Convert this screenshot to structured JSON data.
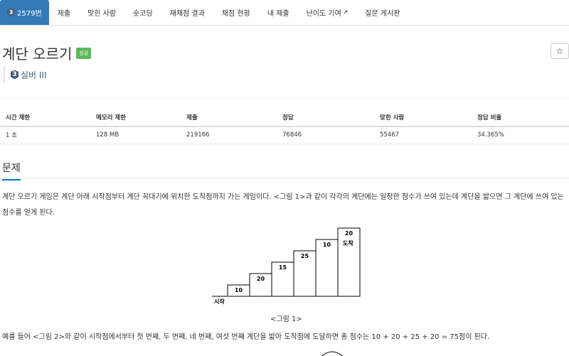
{
  "nav": {
    "tabs": [
      {
        "label": "2579번",
        "tier": "3"
      },
      {
        "label": "제출"
      },
      {
        "label": "맞힌 사람"
      },
      {
        "label": "숏코딩"
      },
      {
        "label": "재채점 결과"
      },
      {
        "label": "채점 현황"
      },
      {
        "label": "내 제출"
      },
      {
        "label": "난이도 기여"
      },
      {
        "label": "질문 게시판"
      }
    ],
    "active_color": "#337ab7"
  },
  "problem": {
    "title": "계단 오르기",
    "status_badge": "성공",
    "star": "☆",
    "tier_num": "3",
    "tier_label": "실버 III"
  },
  "info_table": {
    "headers": [
      "시간 제한",
      "메모리 제한",
      "제출",
      "정답",
      "맞힌 사람",
      "정답 비율"
    ],
    "values": [
      "1 초",
      "128 MB",
      "219166",
      "76846",
      "55467",
      "34.365%"
    ]
  },
  "section": {
    "title": "문제",
    "paragraph1": "계단 오르기 게임은 계단 아래 시작점부터 계단 꼭대기에 위치한 도착점까지 가는 게임이다. <그림 1>과 같이 각각의 계단에는 일정한 점수가 쓰여 있는데 계단을 밟으면 그 계단에 쓰여 있는 점수를 얻게 된다.",
    "figure": {
      "steps": [
        10,
        20,
        15,
        25,
        10,
        20
      ],
      "start_label": "시작",
      "end_label": "도착",
      "caption": "<그림 1>"
    },
    "paragraph2": "예를 들어 <그림 2>와 같이 시작점에서부터 첫 번째, 두 번째, 네 번째, 여섯 번째 계단을 밟아 도착점에 도달하면 총 점수는 10 + 20 + 25 + 20 = 75점이 된다."
  }
}
